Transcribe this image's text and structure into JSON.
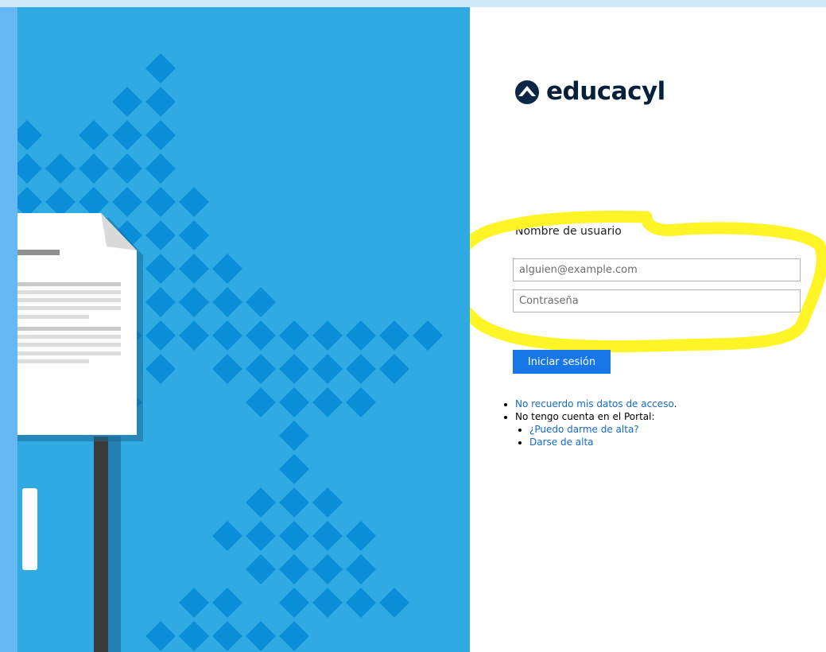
{
  "brand": {
    "name": "educacyl"
  },
  "login": {
    "username_label": "Nombre de usuario",
    "email_placeholder": "alguien@example.com",
    "password_placeholder": "Contraseña",
    "submit_label": "Iniciar sesión"
  },
  "help": {
    "forgot_link": "No recuerdo mis datos de acceso",
    "forgot_suffix": ".",
    "no_account_text": "No tengo cuenta en el Portal:",
    "can_register_link": "¿Puedo darme de alta?",
    "register_link": "Darse de alta"
  },
  "colors": {
    "left_panel": "#2faae3",
    "diamond": "#0a8ed7",
    "button": "#1877e6",
    "link": "#1469c9",
    "highlight": "#fff31a"
  }
}
